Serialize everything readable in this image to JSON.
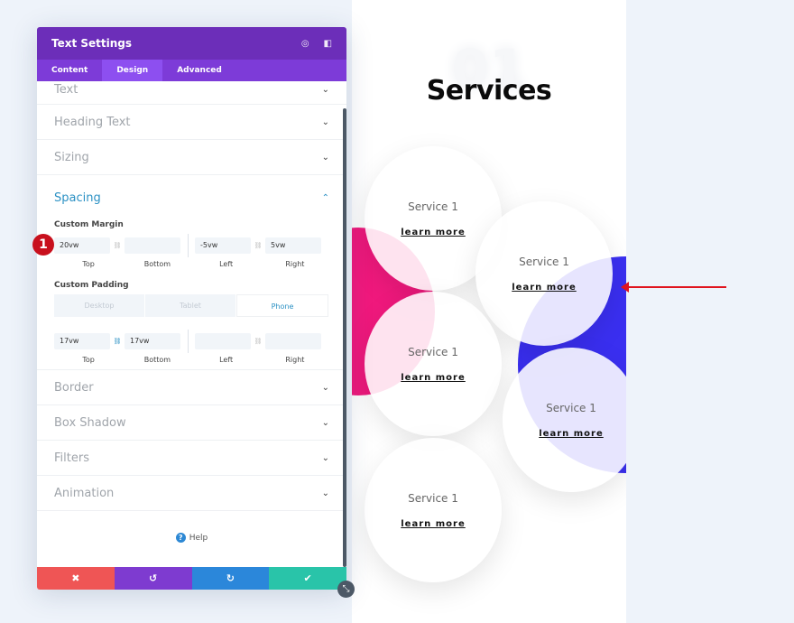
{
  "panel": {
    "title": "Text Settings",
    "tabs": [
      {
        "label": "Content"
      },
      {
        "label": "Design"
      },
      {
        "label": "Advanced"
      }
    ],
    "sections_top": [
      "Text",
      "Heading Text",
      "Sizing"
    ],
    "spacing": {
      "title": "Spacing",
      "margin_label": "Custom Margin",
      "margin": {
        "top": "20vw",
        "bottom": "",
        "left": "-5vw",
        "right": "5vw"
      },
      "padding_label": "Custom Padding",
      "devices": [
        "Desktop",
        "Tablet",
        "Phone"
      ],
      "active_device": "Phone",
      "padding": {
        "top": "17vw",
        "bottom": "17vw",
        "left": "",
        "right": ""
      },
      "captions": {
        "top": "Top",
        "bottom": "Bottom",
        "left": "Left",
        "right": "Right"
      }
    },
    "sections_bottom": [
      "Border",
      "Box Shadow",
      "Filters",
      "Animation"
    ],
    "help": "Help",
    "badge": "1"
  },
  "preview": {
    "bg_number": "01",
    "title": "Services",
    "services": [
      {
        "title": "Service 1",
        "link": "learn more"
      },
      {
        "title": "Service 1",
        "link": "learn more"
      },
      {
        "title": "Service 1",
        "link": "learn more"
      },
      {
        "title": "Service 1",
        "link": "learn more"
      },
      {
        "title": "Service 1",
        "link": "learn more"
      }
    ]
  },
  "colors": {
    "header": "#6c2eb9",
    "pink": "#f0197d",
    "blue": "#3a2ff0",
    "cancel": "#ef5555",
    "undo": "#7e3bd0",
    "redo": "#2b87da",
    "save": "#29c4a9",
    "arrow": "#e0141e"
  }
}
